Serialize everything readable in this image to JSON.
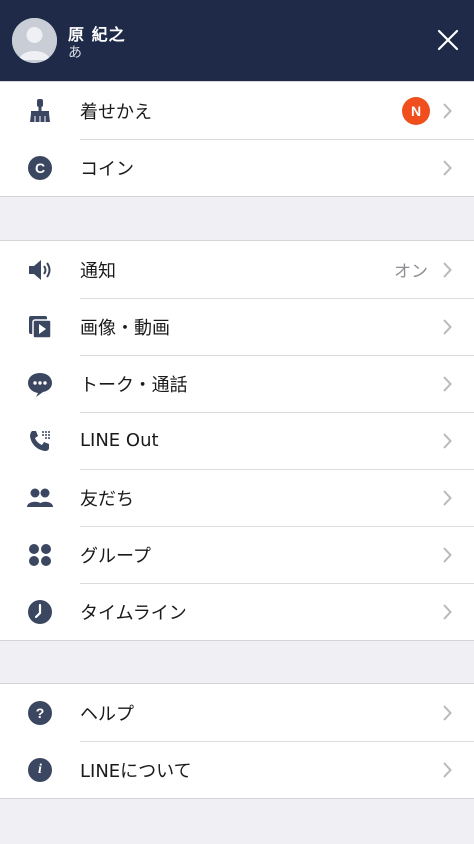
{
  "header": {
    "name": "原 紀之",
    "status": "あ"
  },
  "colors": {
    "header_bg": "#1e2a47",
    "icon": "#3b4760",
    "badge": "#f04e1d",
    "background": "#efeff4"
  },
  "section1": {
    "items": [
      {
        "label": "着せかえ",
        "icon": "brush-icon",
        "badge": "N"
      },
      {
        "label": "コイン",
        "icon": "coin-icon",
        "icon_text": "C"
      }
    ]
  },
  "section2": {
    "items": [
      {
        "label": "通知",
        "icon": "speaker-icon",
        "value": "オン"
      },
      {
        "label": "画像・動画",
        "icon": "media-icon"
      },
      {
        "label": "トーク・通話",
        "icon": "chat-bubble-icon"
      },
      {
        "label": "LINE Out",
        "icon": "phone-icon"
      },
      {
        "label": "友だち",
        "icon": "friends-icon"
      },
      {
        "label": "グループ",
        "icon": "group-icon"
      },
      {
        "label": "タイムライン",
        "icon": "clock-icon"
      }
    ]
  },
  "section3": {
    "items": [
      {
        "label": "ヘルプ",
        "icon": "help-icon",
        "icon_text": "?"
      },
      {
        "label": "LINEについて",
        "icon": "info-icon",
        "icon_text": "i"
      }
    ]
  }
}
